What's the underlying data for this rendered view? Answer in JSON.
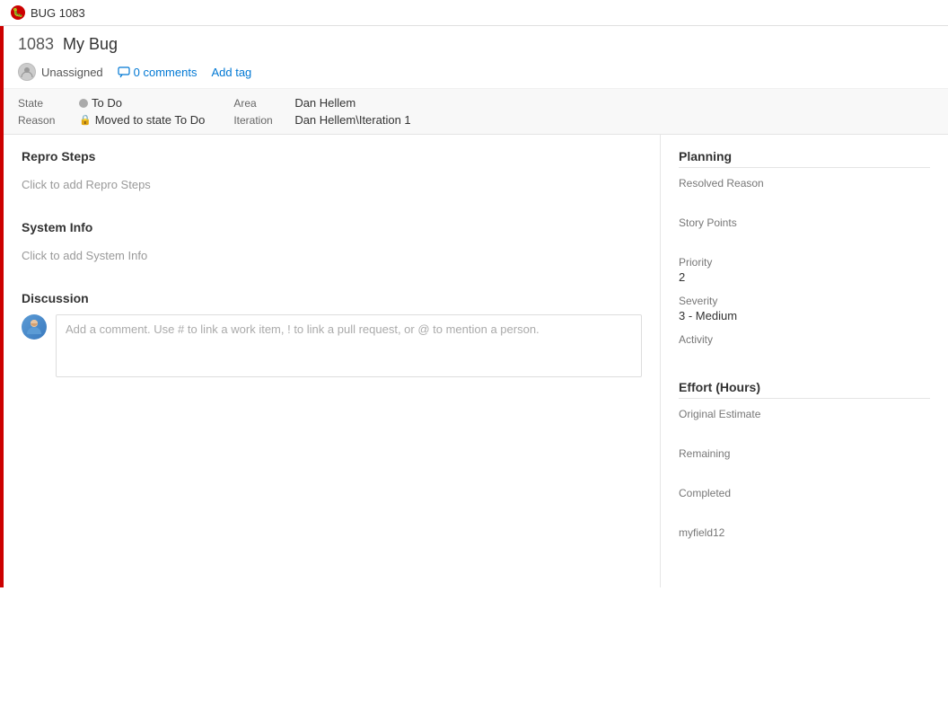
{
  "topBar": {
    "bugIcon": "🐛",
    "title": "BUG 1083"
  },
  "workItem": {
    "id": "1083",
    "title": "My Bug",
    "assignedTo": "Unassigned",
    "commentsCount": "0 comments",
    "addTagLabel": "Add tag"
  },
  "fields": {
    "stateLabel": "State",
    "stateValue": "To Do",
    "reasonLabel": "Reason",
    "reasonValue": "Moved to state To Do",
    "areaLabel": "Area",
    "areaValue": "Dan Hellem",
    "iterationLabel": "Iteration",
    "iterationValue": "Dan Hellem\\Iteration 1"
  },
  "repro": {
    "title": "Repro Steps",
    "placeholder": "Click to add Repro Steps"
  },
  "systemInfo": {
    "title": "System Info",
    "placeholder": "Click to add System Info"
  },
  "discussion": {
    "title": "Discussion",
    "commentPlaceholder": "Add a comment. Use # to link a work item, ! to link a pull request, or @ to mention a person."
  },
  "planning": {
    "title": "Planning",
    "resolvedReasonLabel": "Resolved Reason",
    "resolvedReasonValue": "",
    "storyPointsLabel": "Story Points",
    "storyPointsValue": "",
    "priorityLabel": "Priority",
    "priorityValue": "2",
    "severityLabel": "Severity",
    "severityValue": "3 - Medium",
    "activityLabel": "Activity",
    "activityValue": ""
  },
  "effort": {
    "title": "Effort (Hours)",
    "originalEstimateLabel": "Original Estimate",
    "originalEstimateValue": "",
    "remainingLabel": "Remaining",
    "remainingValue": "",
    "completedLabel": "Completed",
    "completedValue": "",
    "myfield12Label": "myfield12",
    "myfield12Value": ""
  }
}
